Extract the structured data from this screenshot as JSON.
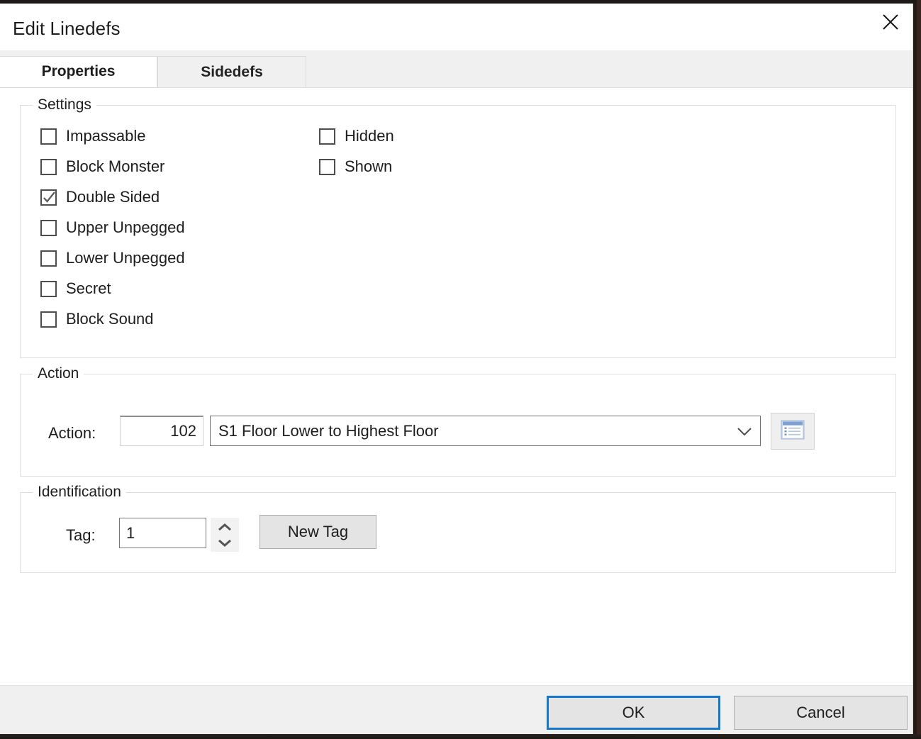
{
  "window": {
    "title": "Edit Linedefs",
    "close_icon": "close-icon"
  },
  "tabs": [
    {
      "label": "Properties",
      "active": true
    },
    {
      "label": "Sidedefs",
      "active": false
    }
  ],
  "groups": {
    "settings": {
      "legend": "Settings",
      "left_column": [
        {
          "label": "Impassable",
          "checked": false
        },
        {
          "label": "Block Monster",
          "checked": false
        },
        {
          "label": "Double Sided",
          "checked": true
        },
        {
          "label": "Upper Unpegged",
          "checked": false
        },
        {
          "label": "Lower Unpegged",
          "checked": false
        },
        {
          "label": "Secret",
          "checked": false
        },
        {
          "label": "Block Sound",
          "checked": false
        }
      ],
      "right_column": [
        {
          "label": "Hidden",
          "checked": false
        },
        {
          "label": "Shown",
          "checked": false
        }
      ]
    },
    "action": {
      "legend": "Action",
      "field_label": "Action:",
      "number_value": "102",
      "combo_value": "S1 Floor Lower to Highest Floor",
      "combo_arrow_icon": "chevron-down-icon",
      "browse_icon": "action-list-browse-icon"
    },
    "identification": {
      "legend": "Identification",
      "tag_label": "Tag:",
      "tag_value": "1",
      "spin_up_icon": "chevron-up-icon",
      "spin_down_icon": "chevron-down-icon",
      "new_tag_label": "New Tag"
    }
  },
  "footer": {
    "ok_label": "OK",
    "cancel_label": "Cancel"
  },
  "colors": {
    "accent_focus": "#1477d1",
    "dialog_bg": "#ffffff",
    "footer_bg": "#f0f0f0",
    "group_border": "#dedede",
    "text": "#1d1d1d"
  }
}
